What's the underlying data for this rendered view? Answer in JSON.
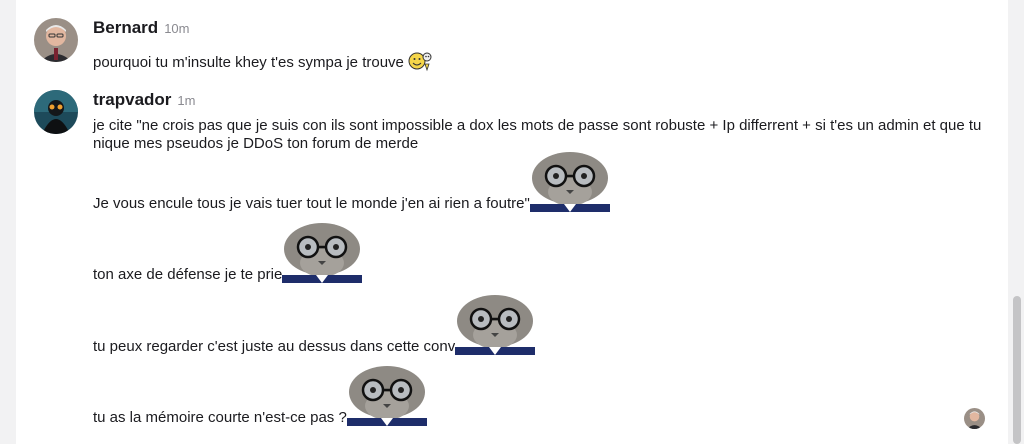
{
  "messages": [
    {
      "author": "Bernard",
      "time": "10m",
      "lines": [
        "pourquoi tu m'insulte khey t'es sympa je trouve"
      ]
    },
    {
      "author": "trapvador",
      "time": "1m",
      "lines": [
        "je cite \"ne crois pas que je suis con ils sont impossible a dox les mots de passe sont robuste + Ip differrent + si t'es un admin et que tu nique mes pseudos je DDoS ton forum de merde",
        "Je vous encule tous je vais tuer tout le monde j'en ai rien a foutre\"",
        "ton axe de défense je te prie",
        "tu peux regarder c'est juste au dessus dans cette conv",
        "tu as la mémoire courte n'est-ce pas ?"
      ]
    }
  ],
  "icons": {
    "smiley": "smiley-emoji-icon",
    "cat": "cat-with-glasses-emote"
  }
}
